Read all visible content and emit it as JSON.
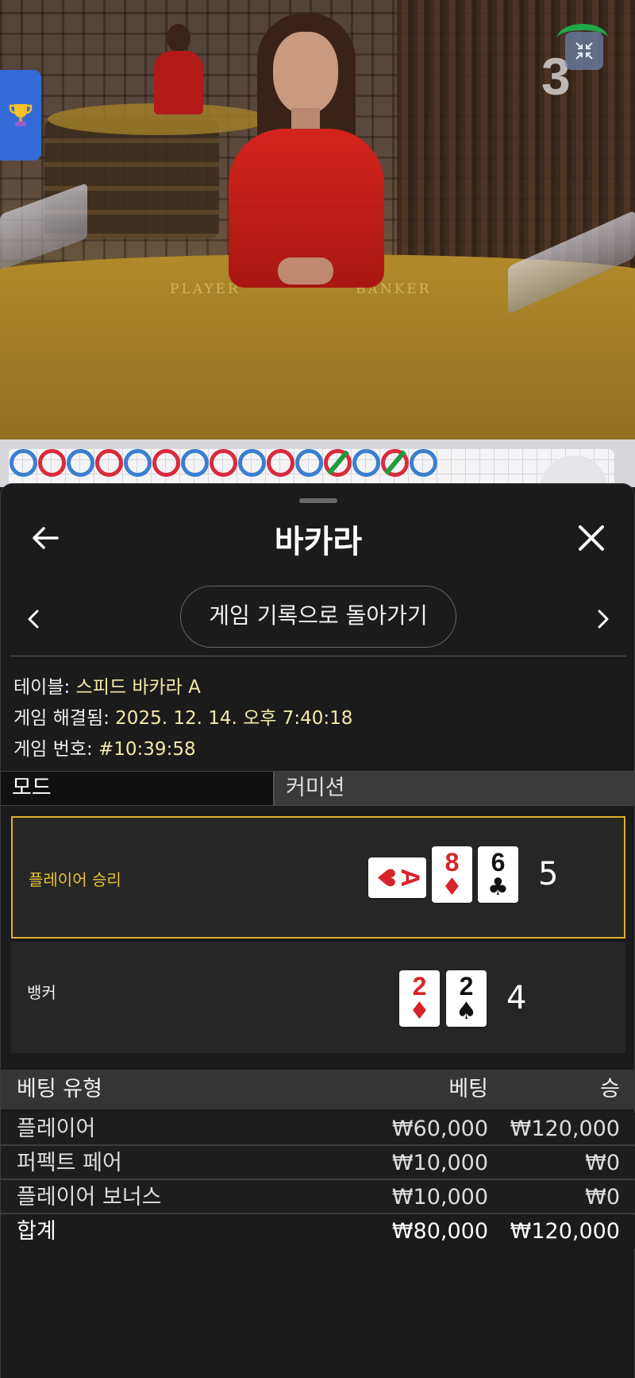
{
  "video": {
    "table_labels": [
      "PLAYER",
      "BANKER"
    ],
    "round_counter": "3",
    "trophy_icon": "trophy-icon",
    "collapse_icon": "collapse-icon"
  },
  "roadmap": {
    "colors": {
      "blue": "#3a7fd0",
      "red": "#d82b3c",
      "green": "#1f9a3b"
    },
    "results": [
      "B",
      "R",
      "B",
      "R",
      "B",
      "R",
      "B",
      "R",
      "B",
      "R",
      "B",
      "R",
      "B",
      "R",
      "B"
    ]
  },
  "sheet": {
    "title": "바카라",
    "back_icon": "arrow-left-icon",
    "close_icon": "close-icon",
    "history_button": "게임 기록으로 돌아가기",
    "prev_icon": "chevron-left-icon",
    "next_icon": "chevron-right-icon"
  },
  "info": {
    "table_label": "테이블: ",
    "table_value": "스피드 바카라 A",
    "resolved_label": "게임 해결됨: ",
    "resolved_value": "2025. 12. 14. 오후 7:40:18",
    "number_label": "게임 번호: ",
    "number_value": "#10:39:58"
  },
  "tabs": {
    "mode": "모드",
    "commission": "커미션"
  },
  "hands": {
    "player": {
      "label": "플레이어 승리",
      "score": "5",
      "cards": [
        {
          "rank": "A",
          "suit": "♥",
          "color": "red",
          "sideways": true
        },
        {
          "rank": "8",
          "suit": "♦",
          "color": "red",
          "sideways": false
        },
        {
          "rank": "6",
          "suit": "♣",
          "color": "black",
          "sideways": false
        }
      ]
    },
    "banker": {
      "label": "뱅커",
      "score": "4",
      "cards": [
        {
          "rank": "2",
          "suit": "♦",
          "color": "red",
          "sideways": false
        },
        {
          "rank": "2",
          "suit": "♠",
          "color": "black",
          "sideways": false
        }
      ]
    }
  },
  "bets": {
    "headers": {
      "type": "베팅 유형",
      "bet": "베팅",
      "win": "승"
    },
    "rows": [
      {
        "type": "플레이어",
        "bet": "₩60,000",
        "win": "₩120,000"
      },
      {
        "type": "퍼펙트 페어",
        "bet": "₩10,000",
        "win": "₩0"
      },
      {
        "type": "플레이어 보너스",
        "bet": "₩10,000",
        "win": "₩0"
      }
    ],
    "total": {
      "type": "합계",
      "bet": "₩80,000",
      "win": "₩120,000"
    }
  },
  "accent_colors": {
    "win_border": "#d9b02a",
    "info_value": "#f4e9a8",
    "card_red": "#d8232a"
  }
}
